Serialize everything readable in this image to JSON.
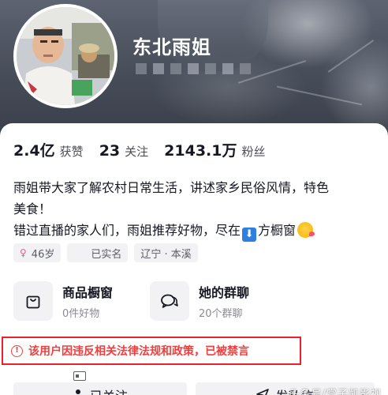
{
  "profile": {
    "nickname": "东北雨姐",
    "nickname_redacted": true
  },
  "stats": [
    {
      "value": "2.4亿",
      "label": "获赞"
    },
    {
      "value": "23",
      "label": "关注"
    },
    {
      "value": "2143.1万",
      "label": "粉丝"
    }
  ],
  "bio": {
    "line1": "雨姐带大家了解农村日常生活，讲述家乡民俗风情，特色",
    "line2": "美食！",
    "line3_before": "错过直播的家人们，雨姐推荐好物，尽在",
    "line3_icon": "⬇",
    "line3_after": "方橱窗",
    "emoji": "kissing-face-emoji"
  },
  "tags": [
    {
      "icon": "female-icon",
      "glyph": "♀",
      "label": "46岁"
    },
    {
      "icon": "id-card-icon",
      "label": "已实名"
    },
    {
      "label": "辽宁 · 本溪"
    }
  ],
  "features": {
    "shop": {
      "title": "商品橱窗",
      "subtitle": "0件好物",
      "icon": "shopping-bag-icon"
    },
    "group": {
      "title": "她的群聊",
      "subtitle": "20个群聊",
      "icon": "chat-bubbles-icon"
    }
  },
  "warning": {
    "glyph": "!",
    "text": "该用户因违反相关法律法规和政策，已被禁言",
    "color": "#f23d3d",
    "border_color": "#e8232f"
  },
  "actions": {
    "follow_label": "已关注",
    "message_label": "发私信"
  },
  "watermark": "头条号/赏子凯影视"
}
